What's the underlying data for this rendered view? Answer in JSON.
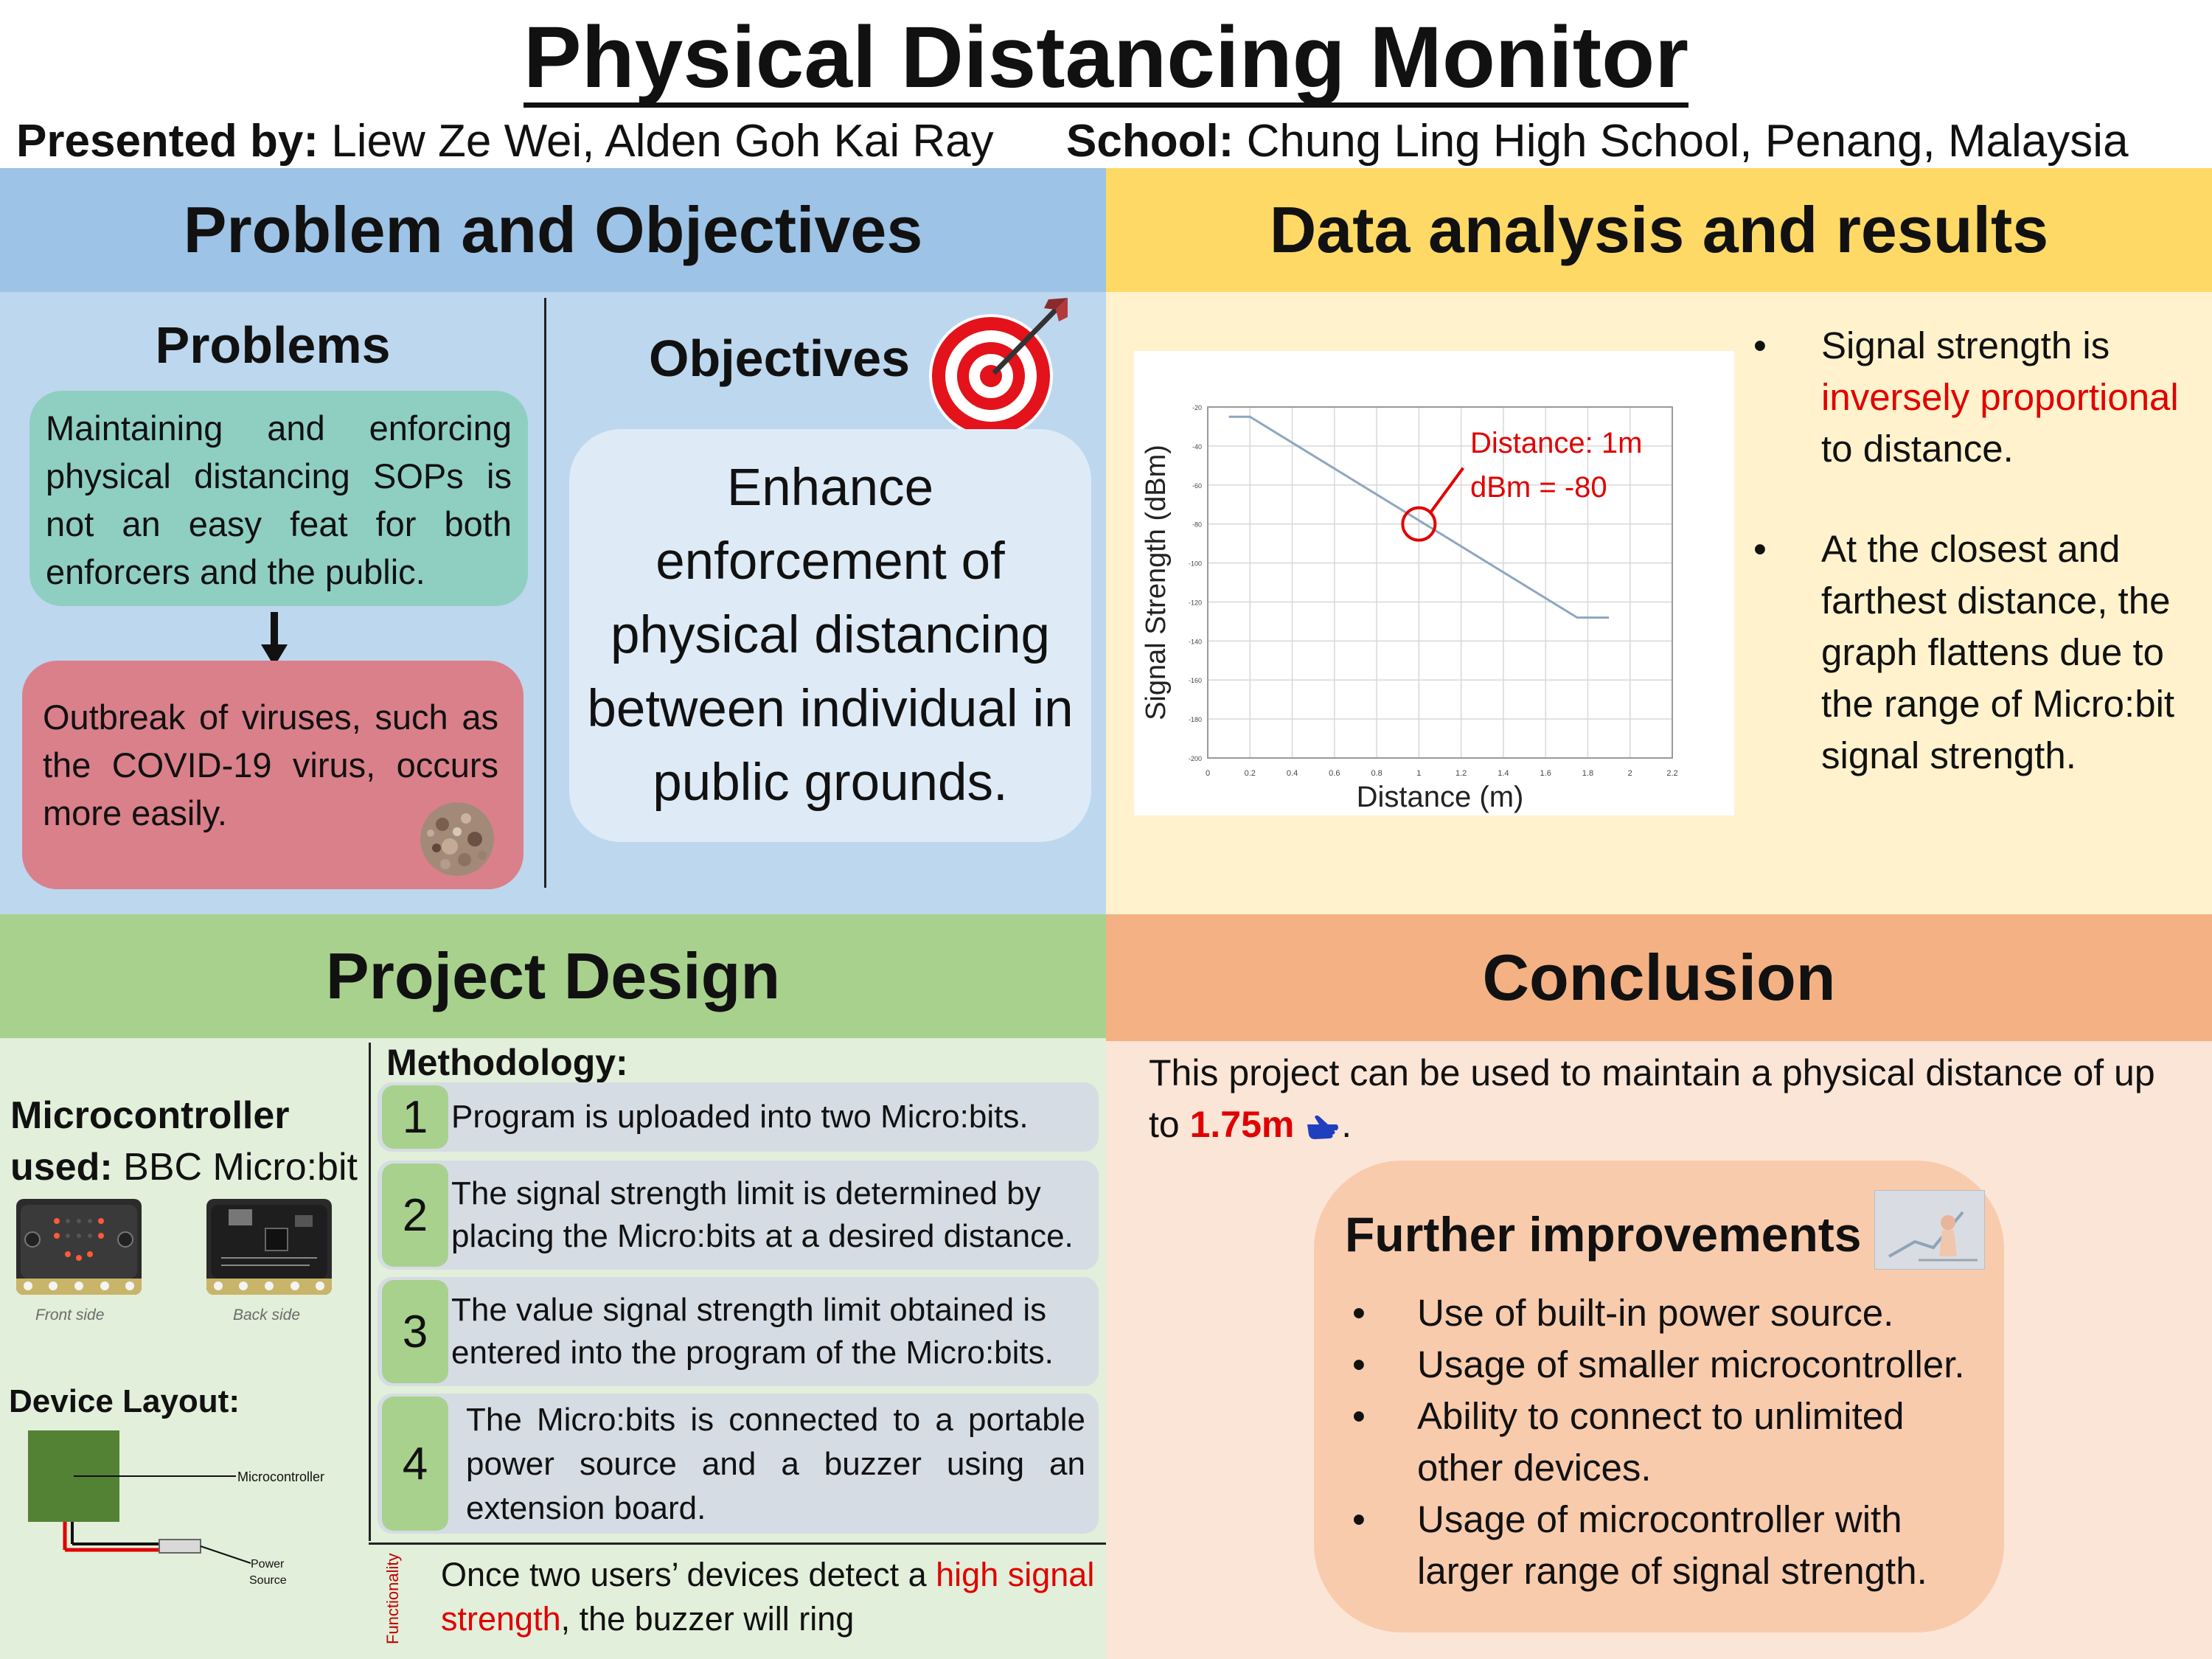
{
  "header": {
    "title": "Physical Distancing Monitor",
    "presented_label": "Presented by:",
    "presenters": "Liew Ze Wei, Alden Goh Kai Ray",
    "school_label": "School:",
    "school": "Chung Ling High School, Penang, Malaysia"
  },
  "problem_objectives": {
    "heading": "Problem and Objectives",
    "problems_title": "Problems",
    "problem_1": "Maintaining and enforcing physical distancing SOPs is not an easy feat for both enforcers and the public.",
    "problem_2": "Outbreak of viruses, such as the COVID-19 virus, occurs more easily.",
    "objectives_title": "Objectives",
    "objective": "Enhance enforcement of physical distancing between individual in public grounds."
  },
  "data_analysis": {
    "heading": "Data analysis and results",
    "bullet_1_a": "Signal strength is ",
    "bullet_1_red": "inversely proportional",
    "bullet_1_b": " to distance.",
    "bullet_2": "At the closest and farthest distance, the graph flattens due to the range of Micro:bit signal strength.",
    "annotation_line1": "Distance: 1m",
    "annotation_line2": "dBm = -80"
  },
  "chart_data": {
    "type": "line",
    "xlabel": "Distance (m)",
    "ylabel": "Signal Strength (dBm)",
    "xlim": [
      0,
      2.2
    ],
    "ylim": [
      -200,
      -20
    ],
    "x_ticks": [
      "0",
      "0.2",
      "0.4",
      "0.6",
      "0.8",
      "1",
      "1.2",
      "1.4",
      "1.6",
      "1.8",
      "2",
      "2.2"
    ],
    "y_ticks": [
      "-20",
      "-40",
      "-60",
      "-80",
      "-100",
      "-120",
      "-140",
      "-160",
      "-180",
      "-200"
    ],
    "grid": true,
    "series": [
      {
        "x": [
          0.1,
          0.2,
          1.75,
          1.9
        ],
        "y": [
          -25,
          -25,
          -128,
          -128
        ]
      }
    ],
    "highlight": {
      "x": 1,
      "y": -80
    },
    "colors": {
      "line": "#8ea6bf",
      "highlight": "#e00000"
    }
  },
  "project_design": {
    "heading": "Project Design",
    "mc_label": "Microcontroller used:",
    "mc_value": "BBC Micro:bit",
    "caption_front": "Front side",
    "caption_back": "Back side",
    "layout_label": "Device Layout:",
    "layout_mc": "Microcontroller",
    "layout_power_1": "Power",
    "layout_power_2": "Source",
    "methodology_title": "Methodology:",
    "steps": [
      {
        "num": "1",
        "text": "Program is uploaded into two Micro:bits."
      },
      {
        "num": "2",
        "text": "The signal strength limit is determined by placing the Micro:bits at a desired distance."
      },
      {
        "num": "3",
        "text": "The value signal strength limit obtained is entered into the program of the Micro:bits."
      },
      {
        "num": "4",
        "text": "The Micro:bits is connected to a portable power source and a buzzer using an extension board."
      }
    ],
    "functionality_label": "Functionality",
    "func_a": "Once two users’ devices detect a ",
    "func_red": "high signal strength",
    "func_b": ", the buzzer will ring"
  },
  "conclusion": {
    "heading": "Conclusion",
    "text_a": "This project can be used to maintain a physical distance of up to ",
    "distance": "1.75m",
    "text_b": ".",
    "further_title": "Further improvements",
    "improvements": [
      "Use of built-in power source.",
      "Usage of smaller microcontroller.",
      "Ability to connect to unlimited other devices.",
      "Usage of microcontroller with larger range of signal strength."
    ]
  }
}
